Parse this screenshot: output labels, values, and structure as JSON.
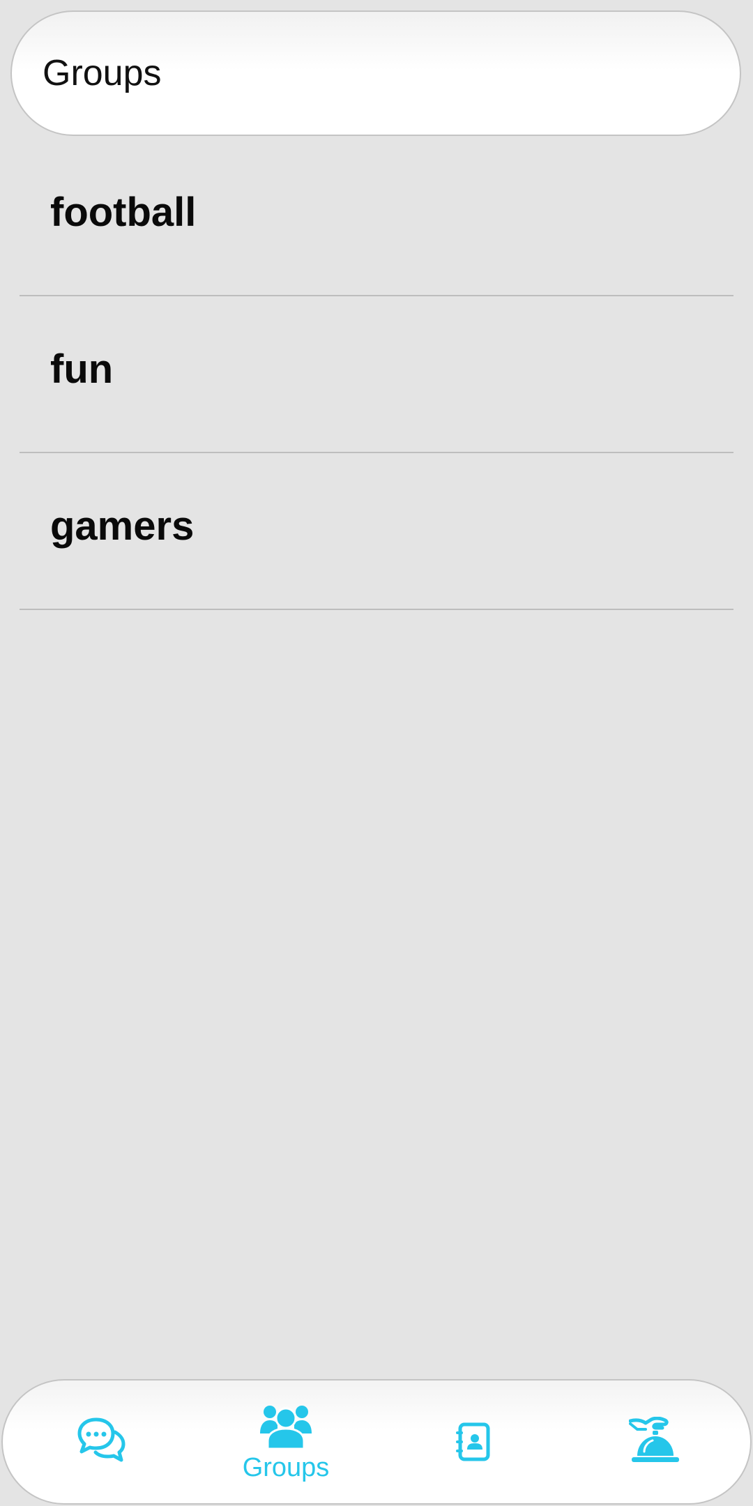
{
  "header": {
    "title": "Groups"
  },
  "groups": [
    {
      "name": "football"
    },
    {
      "name": "fun"
    },
    {
      "name": "gamers"
    }
  ],
  "bottom_nav": {
    "accent_color": "#25c6ea",
    "items": [
      {
        "icon": "chat-bubbles-icon",
        "label": ""
      },
      {
        "icon": "group-icon",
        "label": "Groups",
        "active": true
      },
      {
        "icon": "contacts-book-icon",
        "label": ""
      },
      {
        "icon": "service-bell-icon",
        "label": ""
      }
    ]
  }
}
